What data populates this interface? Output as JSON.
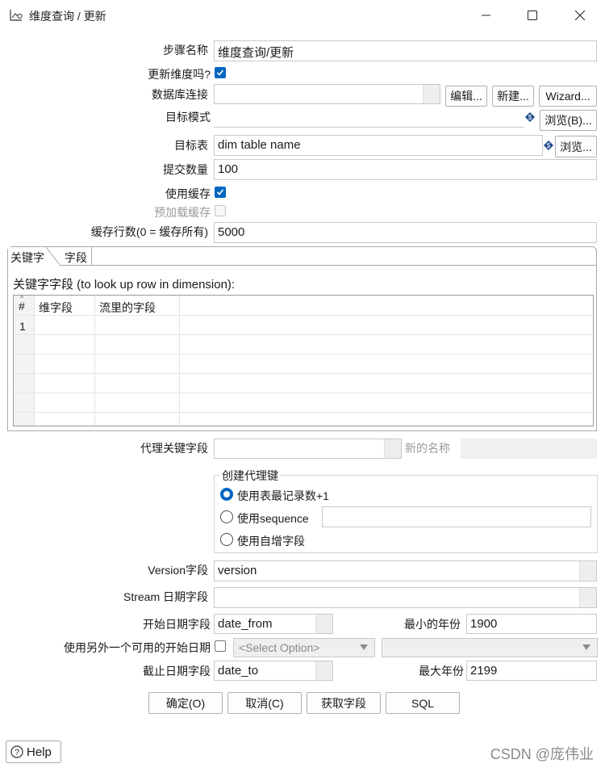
{
  "window": {
    "title": "维度查询 / 更新",
    "icon": "chart-edit-icon",
    "controls": [
      "minimize-icon",
      "maximize-icon",
      "close-icon"
    ]
  },
  "form": {
    "step_name_label": "步骤名称",
    "step_name_value": "维度查询/更新",
    "update_dimension_label": "更新维度吗?",
    "update_dimension_checked": true,
    "db_connection_label": "数据库连接",
    "db_connection_value": "",
    "edit_button": "编辑...",
    "new_button": "新建...",
    "wizard_button": "Wizard...",
    "target_schema_label": "目标模式",
    "target_schema_value": "",
    "browse_schema_button": "浏览(B)...",
    "target_table_label": "目标表",
    "target_table_value": "dim table name",
    "browse_table_button": "浏览...",
    "commit_size_label": "提交数量",
    "commit_size_value": "100",
    "use_cache_label": "使用缓存",
    "use_cache_checked": true,
    "preload_cache_label": "预加载缓存",
    "preload_cache_checked": false,
    "cache_rows_label": "缓存行数(0 = 缓存所有)",
    "cache_rows_value": "5000"
  },
  "tabs": {
    "items": [
      "关键字",
      "字段"
    ],
    "active": "关键字"
  },
  "keys_table": {
    "caption": "关键字字段 (to look up row in dimension):",
    "columns": [
      "#",
      "维字段",
      "流里的字段"
    ],
    "rows": [
      [
        "1",
        "",
        ""
      ]
    ]
  },
  "surrogate": {
    "tech_key_label": "代理关键字段",
    "tech_key_value": "",
    "new_name_label": "新的名称",
    "new_name_value": "",
    "group_title": "创建代理键",
    "options": [
      "使用表最记录数+1",
      "使用sequence",
      "使用自增字段"
    ],
    "selected_option": "使用表最记录数+1",
    "sequence_value": ""
  },
  "versioning": {
    "version_field_label": "Version字段",
    "version_field_value": "version",
    "stream_date_label": "Stream 日期字段",
    "stream_date_value": "",
    "date_from_label": "开始日期字段",
    "date_from_value": "date_from",
    "min_year_label": "最小的年份",
    "min_year_value": "1900",
    "alt_start_label": "使用另外一个可用的开始日期",
    "alt_start_checked": false,
    "alt_start_select": "<Select Option>",
    "alt_start_field": "",
    "date_to_label": "截止日期字段",
    "date_to_value": "date_to",
    "max_year_label": "最大年份",
    "max_year_value": "2199"
  },
  "buttons": {
    "ok": "确定(O)",
    "cancel": "取消(C)",
    "get_fields": "获取字段",
    "sql": "SQL",
    "help": "Help"
  },
  "watermark": "CSDN @庞伟业",
  "colors": {
    "accent": "#0067c0",
    "border": "#c9c9c9",
    "disabled_text": "#9a9a9a"
  }
}
